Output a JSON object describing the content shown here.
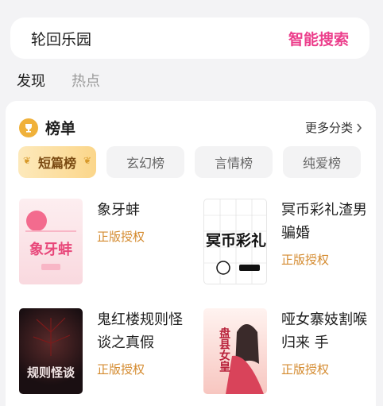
{
  "search": {
    "query": "轮回乐园",
    "button_label": "智能搜索"
  },
  "tabs": [
    {
      "label": "发现",
      "active": true
    },
    {
      "label": "热点",
      "active": false
    }
  ],
  "ranking": {
    "title": "榜单",
    "more_label": "更多分类",
    "chips": [
      {
        "label": "短篇榜",
        "active": true
      },
      {
        "label": "玄幻榜",
        "active": false
      },
      {
        "label": "言情榜",
        "active": false
      },
      {
        "label": "纯爱榜",
        "active": false
      }
    ],
    "books": [
      {
        "title": "象牙蚌",
        "tag": "正版授权",
        "cover_text": "象牙蚌"
      },
      {
        "title": "冥币彩礼渣男骗婚",
        "tag": "正版授权",
        "cover_text": "冥币彩礼"
      },
      {
        "title": "鬼红楼规则怪谈之真假",
        "tag": "正版授权",
        "cover_text": "规则怪谈"
      },
      {
        "title": "哑女寨妓割喉归来 手",
        "tag": "正版授权",
        "cover_text": "盘县女皇"
      }
    ]
  },
  "colors": {
    "accent": "#ec3f8c",
    "tag": "#d48a2e",
    "chip_active": "#fbd68a"
  }
}
